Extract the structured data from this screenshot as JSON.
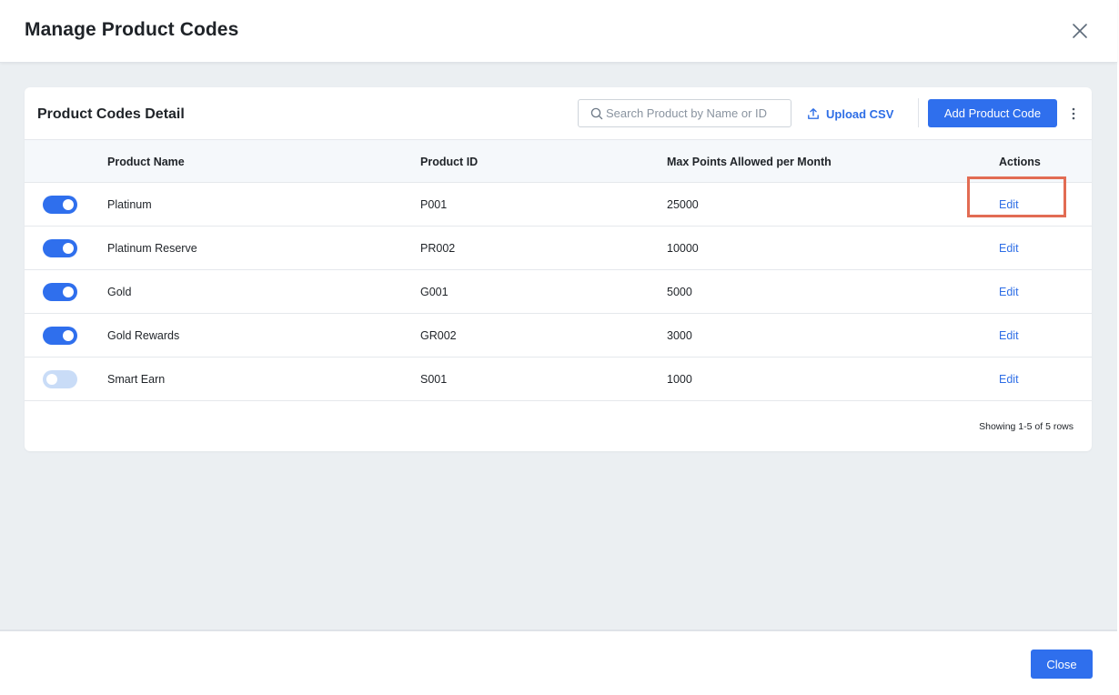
{
  "modal": {
    "title": "Manage Product Codes",
    "close_icon": "close-icon"
  },
  "card": {
    "title": "Product Codes Detail",
    "search_placeholder": "Search Product by Name or ID",
    "upload_label": "Upload CSV",
    "add_label": "Add Product Code",
    "more_icon": "more-vertical-icon"
  },
  "table": {
    "headers": {
      "name": "Product Name",
      "id": "Product ID",
      "max_points": "Max Points Allowed per Month",
      "actions": "Actions"
    },
    "rows": [
      {
        "enabled": true,
        "name": "Platinum",
        "id": "P001",
        "max_points": "25000",
        "action": "Edit"
      },
      {
        "enabled": true,
        "name": "Platinum Reserve",
        "id": "PR002",
        "max_points": "10000",
        "action": "Edit"
      },
      {
        "enabled": true,
        "name": "Gold",
        "id": "G001",
        "max_points": "5000",
        "action": "Edit"
      },
      {
        "enabled": true,
        "name": "Gold Rewards",
        "id": "GR002",
        "max_points": "3000",
        "action": "Edit"
      },
      {
        "enabled": false,
        "name": "Smart Earn",
        "id": "S001",
        "max_points": "1000",
        "action": "Edit"
      }
    ],
    "pagination": "Showing 1-5 of 5 rows"
  },
  "footer": {
    "close_label": "Close"
  },
  "colors": {
    "accent": "#2f6fed",
    "link": "#2e6ee6",
    "highlight": "#e26c53",
    "toggle_off": "#c9dcf7",
    "body_bg": "#ebeff2"
  }
}
